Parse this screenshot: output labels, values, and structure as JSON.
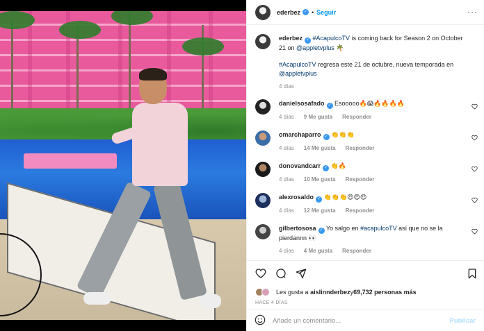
{
  "post": {
    "username": "ederbez",
    "follow_label": "Seguir",
    "dot": "•",
    "more": "···",
    "caption": {
      "username": "ederbez",
      "text_1a": " ",
      "hashtag_1": "#AcapulcoTV",
      "text_1b": " is coming back for Season 2 on October 21 on ",
      "mention": "@appletvplus",
      "emoji_1": "🌴",
      "hashtag_2": "#AcapulcoTV",
      "text_2": " regresa este 21 de octubre, nueva temporada en ",
      "mention_2": "@appletvplus",
      "age": "4 días"
    },
    "comments": [
      {
        "user": "danielsosafado",
        "verified": true,
        "text": "Esooooo🔥😱🔥🔥🔥🔥",
        "age": "4 días",
        "likes": "9 Me gusta",
        "reply": "Responder"
      },
      {
        "user": "omarchaparro",
        "verified": true,
        "text": "👏👏👏",
        "age": "4 días",
        "likes": "14 Me gusta",
        "reply": "Responder"
      },
      {
        "user": "donovandcarr",
        "verified": true,
        "text": "👏🔥",
        "age": "4 días",
        "likes": "10 Me gusta",
        "reply": "Responder"
      },
      {
        "user": "alexrosaldo",
        "verified": true,
        "text": "👏👏👏😍😍😍",
        "age": "4 días",
        "likes": "12 Me gusta",
        "reply": "Responder"
      },
      {
        "user": "gilbertososa",
        "verified": true,
        "text_a": "Yo salgo en ",
        "hashtag": "#acapulcoTV",
        "text_b": " así que no se la pierdannn 👀",
        "age": "4 días",
        "likes": "4 Me gusta",
        "reply": "Responder"
      }
    ],
    "likes": {
      "prefix": "Les gusta a ",
      "user": "aislinnderbez",
      "middle": " y ",
      "count": "69,732 personas más"
    },
    "posted_ago": "HACE 4 DÍAS",
    "composer": {
      "placeholder": "Añade un comentario...",
      "publish": "Publicar"
    }
  },
  "icons": [
    "emoji-icon",
    "heart-icon",
    "comment-icon",
    "share-icon",
    "bookmark-icon",
    "more-icon",
    "verified-badge-icon"
  ],
  "colors": {
    "link": "#0095f6",
    "hashtag": "#00376b",
    "muted": "#8e8e8e",
    "publish_disabled": "#b2dffc"
  }
}
